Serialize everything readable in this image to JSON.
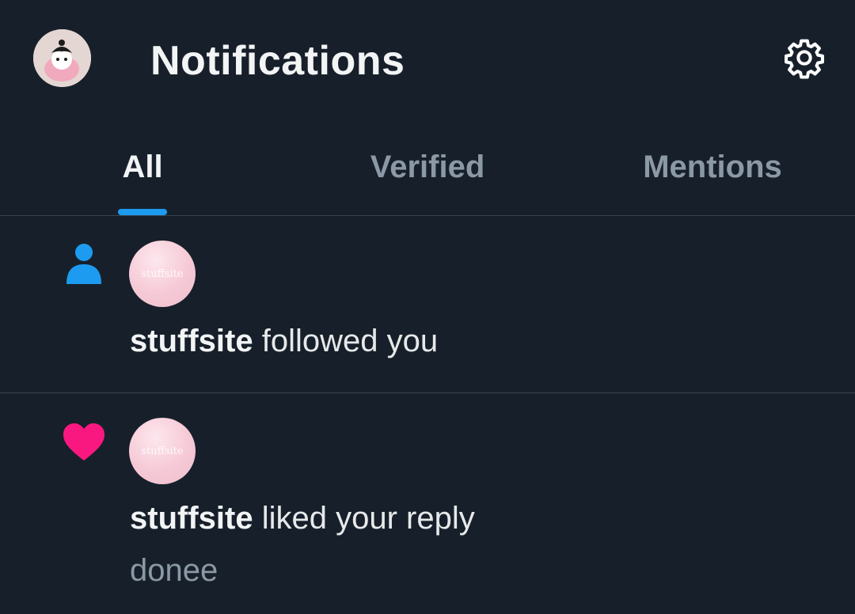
{
  "header": {
    "title": "Notifications",
    "avatar_icon": "profile-avatar",
    "settings_icon": "gear-icon"
  },
  "tabs": [
    {
      "label": "All",
      "active": true
    },
    {
      "label": "Verified",
      "active": false
    },
    {
      "label": "Mentions",
      "active": false
    }
  ],
  "notifications": [
    {
      "type": "follow",
      "icon": "person-icon",
      "icon_color": "#1d9bf0",
      "avatar_text": "stuffsite",
      "username": "stuffsite",
      "action": "followed you"
    },
    {
      "type": "like",
      "icon": "heart-icon",
      "icon_color": "#f91880",
      "avatar_text": "stuffsite",
      "username": "stuffsite",
      "action": "liked your reply",
      "snippet": "donee"
    }
  ],
  "colors": {
    "background": "#17202a",
    "accent": "#1d9bf0",
    "muted_text": "#8b98a5",
    "divider": "#38444d"
  }
}
